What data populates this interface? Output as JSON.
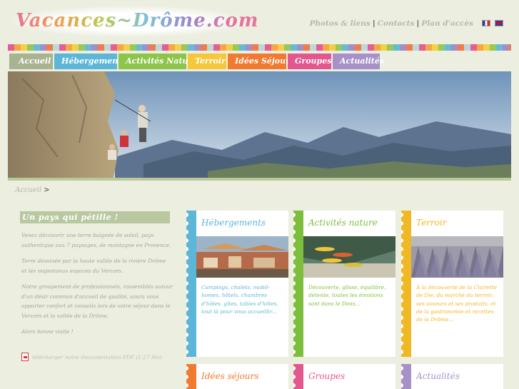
{
  "site": {
    "logo": "Vacances~Drôme.com"
  },
  "toplinks": [
    {
      "label": "Photos & liens"
    },
    {
      "label": "Contacts"
    },
    {
      "label": "Plan d'accès"
    }
  ],
  "separator": "|",
  "nav": [
    {
      "label": "Accueil",
      "color": "#a8b390"
    },
    {
      "label": "Hébergements",
      "color": "#5cb6d8"
    },
    {
      "label": "Activités Nature",
      "color": "#8cc54a"
    },
    {
      "label": "Terroir",
      "color": "#f6c73a"
    },
    {
      "label": "Idées Séjours",
      "color": "#f07a30"
    },
    {
      "label": "Groupes",
      "color": "#e3578f"
    },
    {
      "label": "Actualités",
      "color": "#a792c8"
    }
  ],
  "breadcrumb": {
    "home": "Accueil",
    "sep": ">"
  },
  "intro": {
    "title": "Un pays qui pétille !",
    "paragraphs": [
      "Venez découvrir une terre baignée de soleil, pays authentique aux 7 paysages, de montagne en Provence.",
      "Terre dessinée par la haute vallée de la rivière Drôme et les majestueux espaces du Vercors.",
      "Notre groupement de professionnels, rassemblés autour d'un désir commun d'accueil de qualité, saura vous apporter confort et conseils lors de votre séjour dans le Vercors et la vallée de la Drôme.",
      "Alors bonne visite !"
    ],
    "download": "télécharger notre documentation PDF (1.27 Mo)"
  },
  "cards": [
    {
      "title": "Hébergements",
      "color": "#5cb6d8",
      "text": "Campings, chalets, mobil-homes, hôtels, chambres d'hôtes, gîtes, tables d'hôtes, tout là pour vous accueillir..."
    },
    {
      "title": "Activités nature",
      "color": "#7dbf3c",
      "text": "Découverte, glisse, équilibre, détente, toutes les émotions sont dans le Diois..."
    },
    {
      "title": "Terroir",
      "color": "#f0b824",
      "text": "À la découverte de la Clairette de Die, du marché du terroir, ses saveurs et ses produits, et de la gastronomie et recettes de la Drôme..."
    },
    {
      "title": "Idées séjours",
      "color": "#f07a30"
    },
    {
      "title": "Groupes",
      "color": "#e3578f"
    },
    {
      "title": "Actualités",
      "color": "#a792c8"
    }
  ]
}
